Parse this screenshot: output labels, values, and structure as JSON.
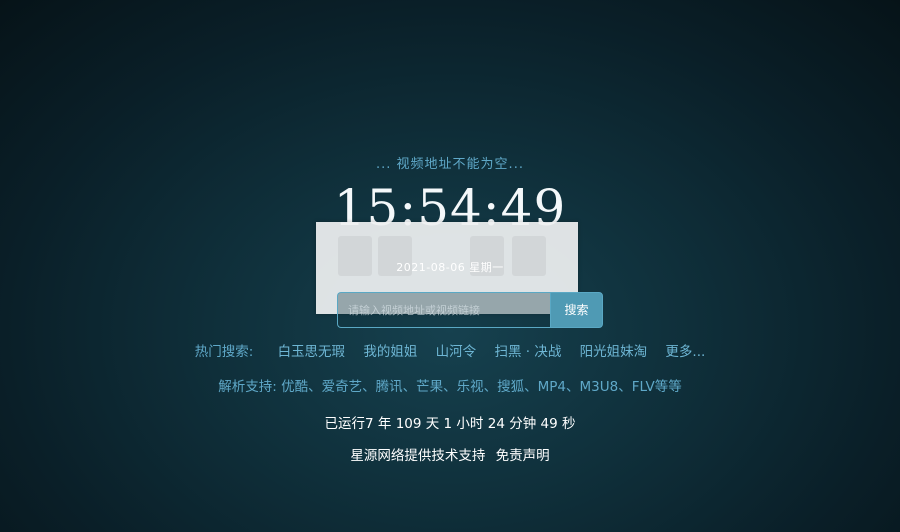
{
  "notice": "... 视频地址不能为空...",
  "clock": "15:54:49",
  "date": "2021-08-06 星期一",
  "search": {
    "placeholder": "请输入视频地址或视频链接",
    "button_label": "搜索"
  },
  "hot": {
    "label": "热门搜索:",
    "items": [
      "白玉思无瑕",
      "我的姐姐",
      "山河令",
      "扫黑 · 决战",
      "阳光姐妹淘"
    ],
    "more": "更多..."
  },
  "support": "解析支持: 优酷、爱奇艺、腾讯、芒果、乐视、搜狐、MP4、M3U8、FLV等等",
  "uptime": "已运行7 年 109 天 1 小时 24 分钟 49 秒",
  "footer": {
    "provider": "星源网络提供技术支持",
    "disclaimer": "免责声明"
  }
}
